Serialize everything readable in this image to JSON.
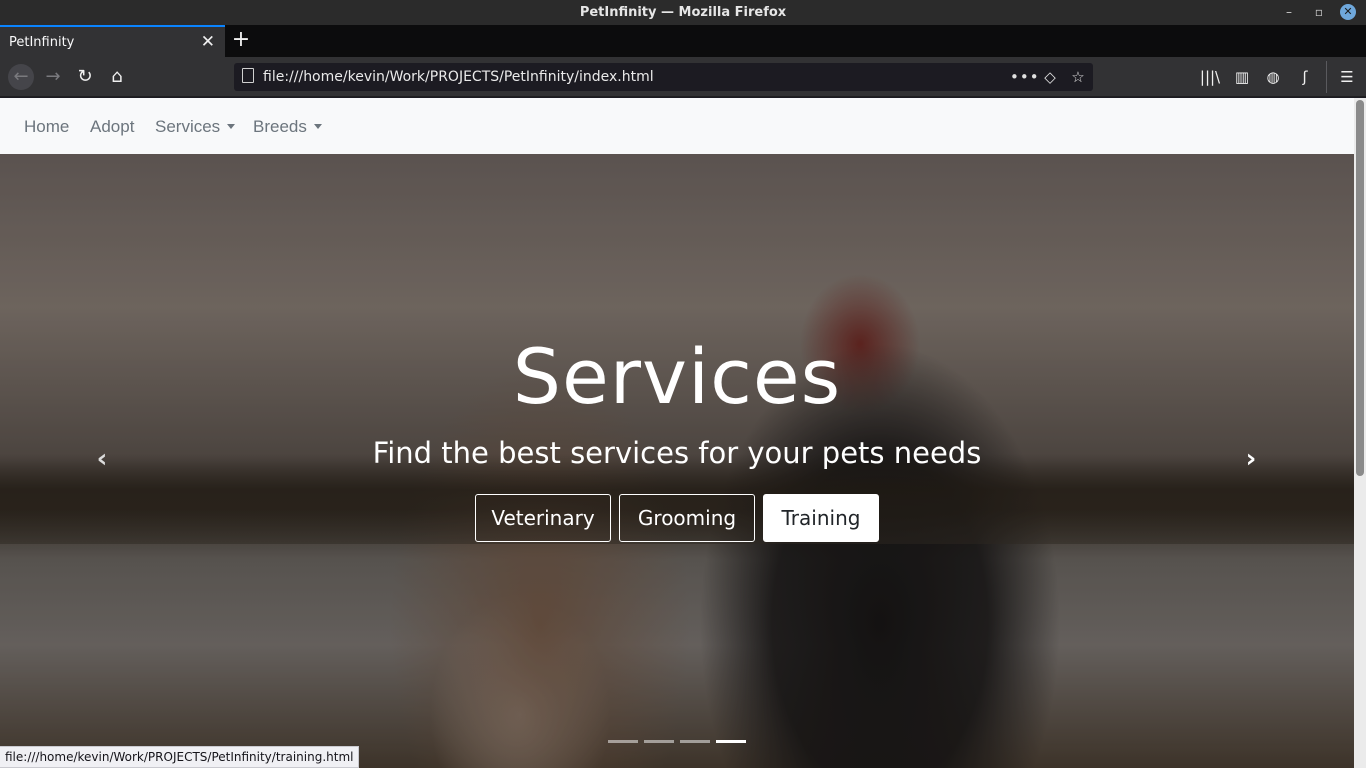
{
  "window": {
    "title": "PetInfinity — Mozilla Firefox",
    "controls": {
      "minimize": "–",
      "maximize": "▫",
      "close": "✕"
    }
  },
  "tabs": [
    {
      "label": "PetInfinity",
      "close": "✕",
      "active": true
    }
  ],
  "new_tab_label": "+",
  "navbar": {
    "back": "←",
    "forward": "→",
    "reload": "↻",
    "home": "⌂",
    "url": "file:///home/kevin/Work/PROJECTS/PetInfinity/index.html",
    "page_actions": "•••",
    "pocket": "◇",
    "bookmark_star": "☆",
    "library": "|||\\",
    "sidebar": "▥",
    "globe": "◍",
    "sync": "ʃ",
    "menu": "☰"
  },
  "site": {
    "nav": {
      "home": "Home",
      "adopt": "Adopt",
      "services": "Services",
      "breeds": "Breeds"
    },
    "hero": {
      "title": "Services",
      "subtitle": "Find the best services for your pets needs",
      "buttons": {
        "veterinary": "Veterinary",
        "grooming": "Grooming",
        "training": "Training"
      },
      "prev_arrow": "‹",
      "next_arrow": "›",
      "active_slide": 4,
      "slide_count": 4
    }
  },
  "status_link": "file:///home/kevin/Work/PROJECTS/PetInfinity/training.html",
  "colors": {
    "tab_accent": "#0a84ff",
    "toolbar_bg": "#323234",
    "nav_bg": "#f8f9fa",
    "nav_link": "#6c757d"
  }
}
